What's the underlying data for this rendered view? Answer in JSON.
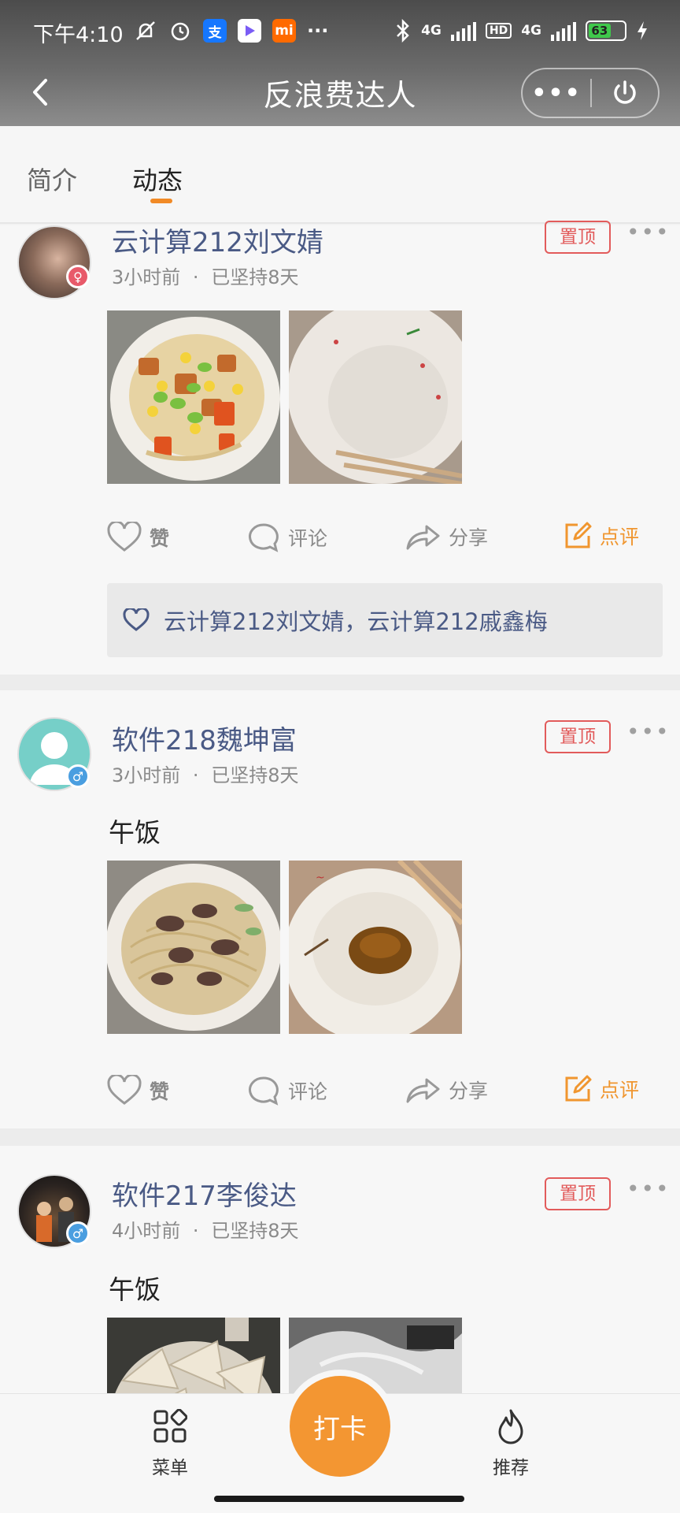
{
  "status_bar": {
    "time": "下午4:10",
    "net_label_1": "4G",
    "hd_label": "HD",
    "net_label_2": "4G",
    "battery": "63",
    "battery_level": 0.63,
    "icons": [
      "mute-bell-icon",
      "alarm-icon",
      "alipay-icon",
      "video-app-icon",
      "mi-icon",
      "more-dots-icon",
      "bluetooth-icon",
      "signal-icon",
      "battery-icon",
      "charging-icon"
    ]
  },
  "header": {
    "title": "反浪费达人",
    "more_label": "•••"
  },
  "tabs": [
    {
      "label": "简介"
    },
    {
      "label": "动态"
    }
  ],
  "posts": [
    {
      "user": "云计算212刘文婧",
      "time": "3小时前",
      "streak": "已坚持8天",
      "separator": "·",
      "pin": "置顶",
      "more": "•••",
      "text": "",
      "photos": [
        "noodles-with-chicken-and-vegetables",
        "empty-bowl-with-chopsticks"
      ],
      "likes": "云计算212刘文婧，云计算212戚鑫梅"
    },
    {
      "user": "软件218魏坤富",
      "time": "3小时前",
      "streak": "已坚持8天",
      "separator": "·",
      "pin": "置顶",
      "more": "•••",
      "text": "午饭",
      "photos": [
        "noodles-with-beef",
        "bowl-with-leftover-sauce"
      ]
    },
    {
      "user": "软件217李俊达",
      "time": "4小时前",
      "streak": "已坚持8天",
      "separator": "·",
      "pin": "置顶",
      "more": "•••",
      "text": "午饭",
      "photos": [
        "rice-noodle-sheets",
        "plastic-bag-food"
      ]
    }
  ],
  "actions": {
    "like": "赞",
    "comment": "评论",
    "share": "分享",
    "review": "点评"
  },
  "bottom_nav": {
    "menu": "菜单",
    "checkin": "打卡",
    "recommend": "推荐"
  },
  "colors": {
    "accent": "#f39632",
    "name": "#4a5a85",
    "pin": "#e25b5b",
    "male": "#4a9ee0",
    "female": "#e85a6a"
  }
}
